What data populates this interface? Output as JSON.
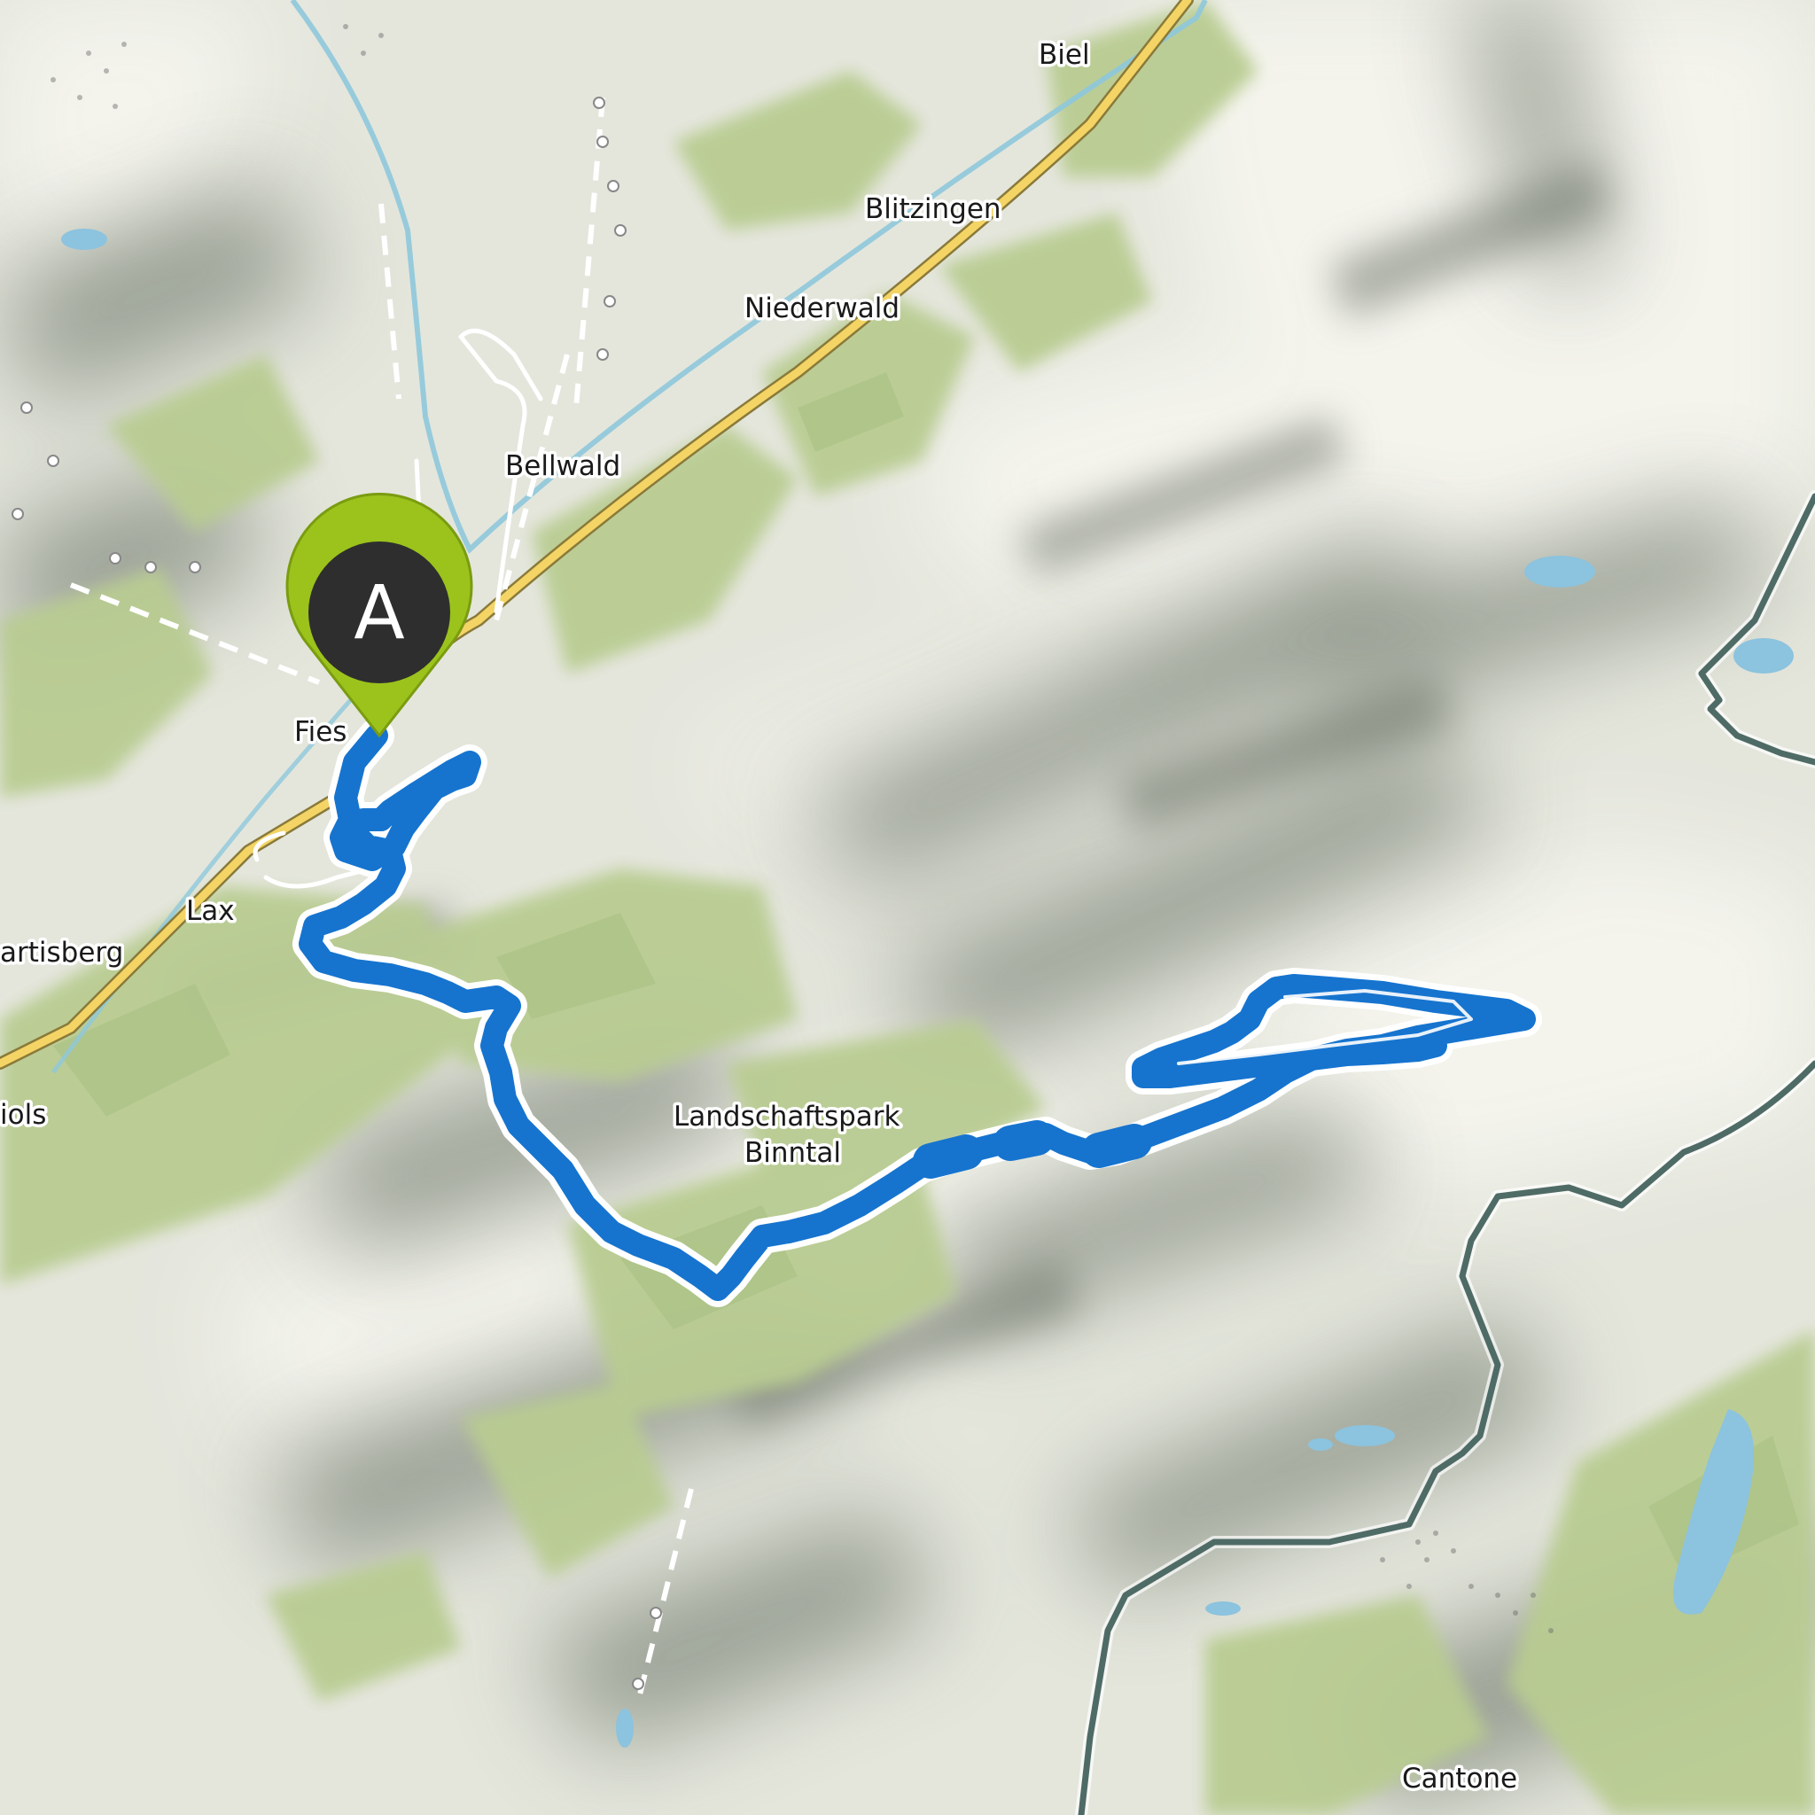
{
  "map": {
    "places": {
      "biel": "Biel",
      "blitzingen": "Blitzingen",
      "niederwald": "Niederwald",
      "bellwald": "Bellwald",
      "fiesch": "Fies",
      "lax": "Lax",
      "martisberg": "artisberg",
      "grengiols": "iols",
      "park_line1": "Landschaftspark",
      "park_line2": "Binntal",
      "cantone": "Cantone"
    },
    "start_marker": {
      "letter": "A",
      "color": "#9bc31c"
    },
    "route": {
      "color": "#1674cf",
      "casing": "#ffffff"
    },
    "colors": {
      "terrain": "#e4e6dc",
      "forest": "#b9cc92",
      "valley_road": "#f3d465",
      "river": "#8ec8dc",
      "lake": "#8cc3de",
      "border": "#4f6b66"
    }
  }
}
